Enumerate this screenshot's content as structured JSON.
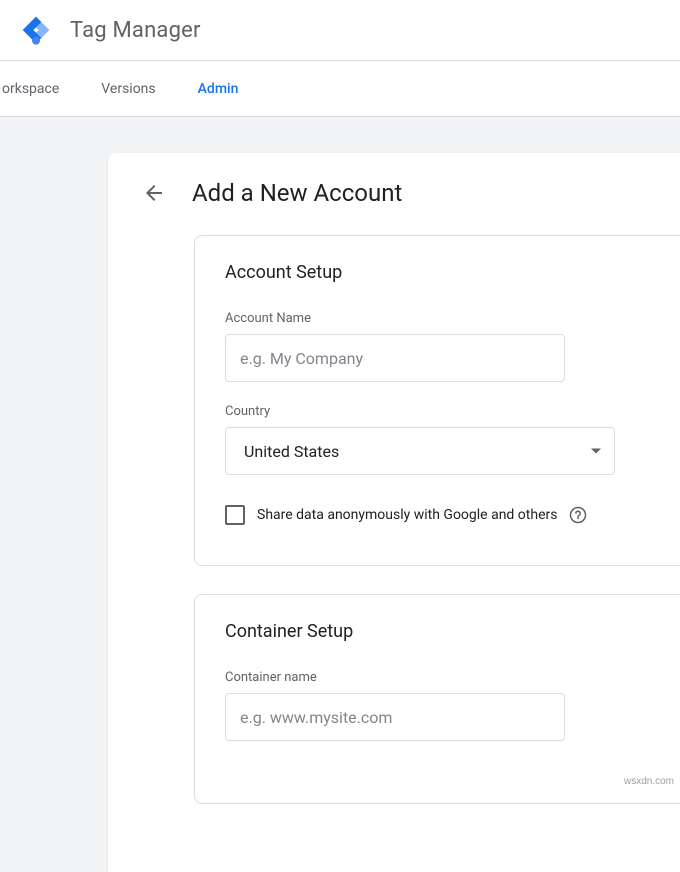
{
  "header": {
    "app_title": "Tag Manager"
  },
  "tabs": {
    "workspace": "orkspace",
    "versions": "Versions",
    "admin": "Admin"
  },
  "panel": {
    "title": "Add a New Account"
  },
  "account_setup": {
    "card_title": "Account Setup",
    "account_name_label": "Account Name",
    "account_name_placeholder": "e.g. My Company",
    "country_label": "Country",
    "country_value": "United States",
    "share_label": "Share data anonymously with Google and others"
  },
  "container_setup": {
    "card_title": "Container Setup",
    "container_name_label": "Container name",
    "container_name_placeholder": "e.g. www.mysite.com"
  },
  "watermark": "wsxdn.com"
}
